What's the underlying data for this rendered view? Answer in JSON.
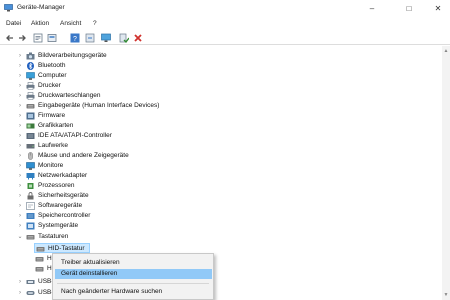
{
  "window": {
    "title": "Geräte-Manager"
  },
  "window_controls": {
    "minimize": "–",
    "maximize": "□",
    "close": "✕"
  },
  "menu": [
    "Datei",
    "Aktion",
    "Ansicht",
    "?"
  ],
  "toolbar": [
    "back-icon",
    "forward-icon",
    "properties-icon",
    "show-hidden-icon",
    "help-icon",
    "update-driver-icon",
    "monitor-icon",
    "enable-device-icon",
    "uninstall-icon"
  ],
  "tree": {
    "categories": [
      {
        "label": "Bildverarbeitungsgeräte",
        "icon": "camera-icon",
        "color": "#6a7b8c",
        "expanded": false
      },
      {
        "label": "Bluetooth",
        "icon": "bluetooth-icon",
        "color": "#1f5fbf",
        "expanded": false
      },
      {
        "label": "Computer",
        "icon": "computer-icon",
        "color": "#3aa0d8",
        "expanded": false
      },
      {
        "label": "Drucker",
        "icon": "printer-icon",
        "color": "#6c7a88",
        "expanded": false
      },
      {
        "label": "Druckwarteschlangen",
        "icon": "printer-queue-icon",
        "color": "#6c7a88",
        "expanded": false
      },
      {
        "label": "Eingabegeräte (Human Interface Devices)",
        "icon": "hid-icon",
        "color": "#7b7b7b",
        "expanded": false
      },
      {
        "label": "Firmware",
        "icon": "firmware-icon",
        "color": "#4e6e8e",
        "expanded": false
      },
      {
        "label": "Grafikkarten",
        "icon": "display-adapter-icon",
        "color": "#3d7a3d",
        "expanded": false
      },
      {
        "label": "IDE ATA/ATAPI-Controller",
        "icon": "ide-controller-icon",
        "color": "#5a6a7a",
        "expanded": false
      },
      {
        "label": "Laufwerke",
        "icon": "disk-drive-icon",
        "color": "#666f78",
        "expanded": false
      },
      {
        "label": "Mäuse und andere Zeigegeräte",
        "icon": "mouse-icon",
        "color": "#888888",
        "expanded": false
      },
      {
        "label": "Monitore",
        "icon": "monitor-icon",
        "color": "#2f8fd0",
        "expanded": false
      },
      {
        "label": "Netzwerkadapter",
        "icon": "network-adapter-icon",
        "color": "#2f7fc0",
        "expanded": false
      },
      {
        "label": "Prozessoren",
        "icon": "processor-icon",
        "color": "#3f8f3f",
        "expanded": false
      },
      {
        "label": "Sicherheitsgeräte",
        "icon": "security-device-icon",
        "color": "#6d6d6d",
        "expanded": false
      },
      {
        "label": "Softwaregeräte",
        "icon": "software-device-icon",
        "color": "#6d7d8d",
        "expanded": false
      },
      {
        "label": "Speichercontroller",
        "icon": "storage-controller-icon",
        "color": "#3f7fbf",
        "expanded": false
      },
      {
        "label": "Systemgeräte",
        "icon": "system-device-icon",
        "color": "#3f7fbf",
        "expanded": false
      },
      {
        "label": "Tastaturen",
        "icon": "keyboard-icon",
        "color": "#7a7a7a",
        "expanded": true
      }
    ],
    "keyboards": [
      {
        "label": "HID-Tastatur",
        "selected": true
      },
      {
        "label": "H",
        "selected": false
      },
      {
        "label": "H",
        "selected": false
      }
    ],
    "after": [
      {
        "label": "USB-",
        "icon": "usb-icon"
      },
      {
        "label": "USB-C",
        "icon": "usb-c-icon"
      }
    ]
  },
  "context_menu": {
    "items": [
      {
        "label": "Treiber aktualisieren",
        "highlighted": false
      },
      {
        "label": "Gerät deinstallieren",
        "highlighted": true
      },
      {
        "label": "Nach geänderter Hardware suchen",
        "highlighted": false
      }
    ]
  },
  "colors": {
    "selection": "#cce8ff",
    "menu_highlight": "#91c9f7",
    "uninstall_red": "#d0312d",
    "enable_green": "#2e8b2e"
  }
}
